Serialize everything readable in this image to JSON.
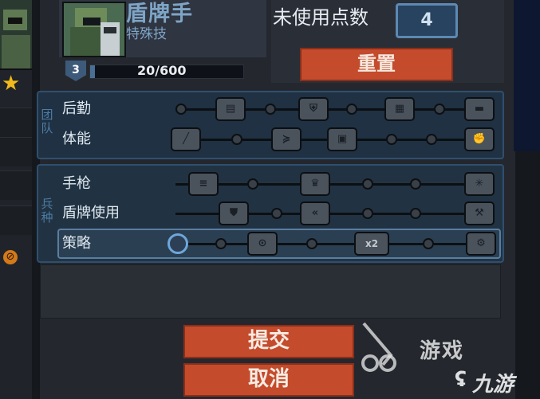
{
  "header": {
    "class_title": "盾牌手",
    "class_subtitle": "特殊技",
    "level": "3",
    "xp_text": "20/600",
    "xp_progress": 0.033,
    "unused_points_label": "未使用点数",
    "unused_points_value": "4",
    "reset_label": "重置"
  },
  "sections": [
    {
      "label": "团队",
      "rows": [
        {
          "label": "后勤",
          "nodes": [
            "supply-icon",
            "shield-plus-icon",
            "grid-icon",
            "crate-icon"
          ]
        },
        {
          "label": "体能",
          "nodes": [
            "knife-icon",
            "arrows-icon",
            "blocks-icon",
            "fist-icon"
          ]
        }
      ]
    },
    {
      "label": "兵种",
      "rows": [
        {
          "label": "手枪",
          "nodes": [
            "ammo-icon",
            "crown-icon",
            "burst-icon"
          ]
        },
        {
          "label": "盾牌使用",
          "nodes": [
            "shield-icon",
            "chevrons-icon",
            "wrench-icon"
          ]
        },
        {
          "label": "策略",
          "nodes": [
            "active-node",
            "cannon-icon",
            "x2-badge",
            "gear-icon"
          ],
          "x2_text": "x2"
        }
      ]
    }
  ],
  "footer": {
    "submit_label": "提交",
    "cancel_label": "取消"
  },
  "watermark": {
    "text1": "游戏",
    "text2": "九游"
  },
  "colors": {
    "accent_red": "#c44b2c",
    "accent_blue": "#5d89b3",
    "star": "#f1b91c"
  }
}
